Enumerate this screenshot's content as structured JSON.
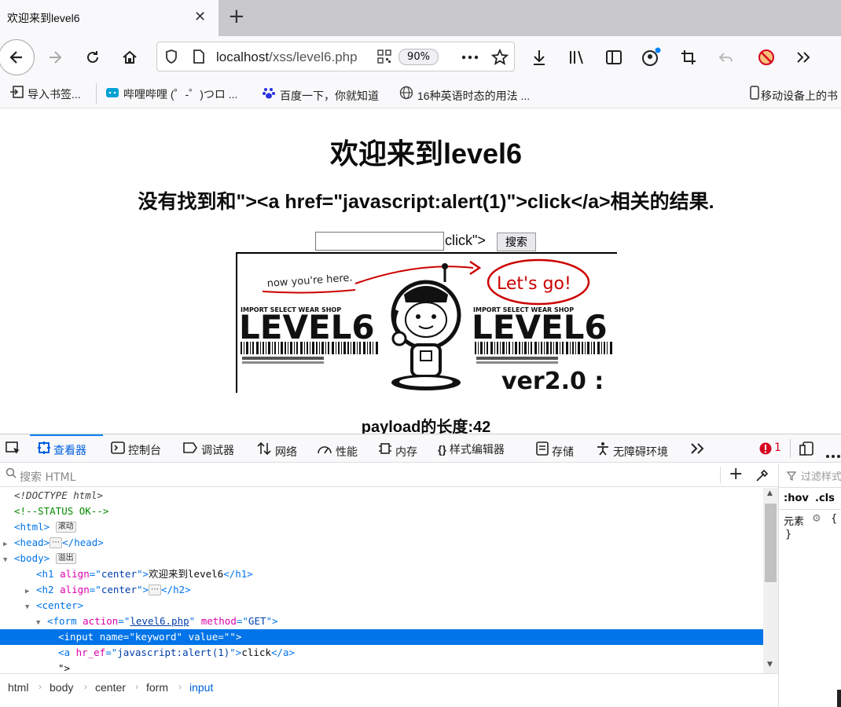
{
  "tab": {
    "title": "欢迎来到level6",
    "close": "✕",
    "new_tab": "+"
  },
  "nav": {
    "url_host": "localhost",
    "url_path": "/xss/level6.php",
    "zoom": "90%"
  },
  "bookmarks": [
    {
      "label": "导入书签...",
      "icon": "import-icon"
    },
    {
      "label": "哔哩哔哩 (゜-゜)つロ ...",
      "icon": "bilibili-icon"
    },
    {
      "label": "百度一下，你就知道",
      "icon": "baidu-icon"
    },
    {
      "label": "16种英语时态的用法 ...",
      "icon": "globe-icon"
    },
    {
      "label": "移动设备上的书",
      "icon": "mobile-icon"
    }
  ],
  "page": {
    "heading": "欢迎来到level6",
    "result": "没有找到和\"><a href=\"javascript:alert(1)\">click</a>相关的结果.",
    "input_value": "",
    "after_input": "click\">",
    "search_button": "搜索",
    "payload_length": "payload的长度:42"
  },
  "banner": {
    "note": "now you're here.",
    "go": "Let's go!",
    "shop": "IMPORT SELECT WEAR SHOP",
    "level": "LEVEL6",
    "version": "ver2.0 :"
  },
  "devtools": {
    "tabs": [
      "查看器",
      "控制台",
      "调试器",
      "网络",
      "性能",
      "内存",
      "样式编辑器",
      "存储",
      "无障碍环境"
    ],
    "error_count": "1",
    "search_placeholder": "搜索 HTML",
    "filter_placeholder": "过滤样式",
    "hov": ":hov",
    "cls": ".cls",
    "element_rule": "元素",
    "brace_open": "{",
    "brace_close": "}",
    "markup": {
      "doctype": "<!DOCTYPE html>",
      "comment": "<!--STATUS OK-->",
      "html_badge": "滚动",
      "body_badge": "溢出",
      "h1_text": "欢迎来到level6",
      "form_action": "level6.php",
      "form_method": "GET",
      "input_name": "keyword",
      "input_value": "",
      "a_attr": "hr_ef",
      "a_href": "javascript:alert(1)",
      "a_text": "click",
      "text_node": "\">"
    },
    "breadcrumbs": [
      "html",
      "body",
      "center",
      "form",
      "input"
    ]
  }
}
